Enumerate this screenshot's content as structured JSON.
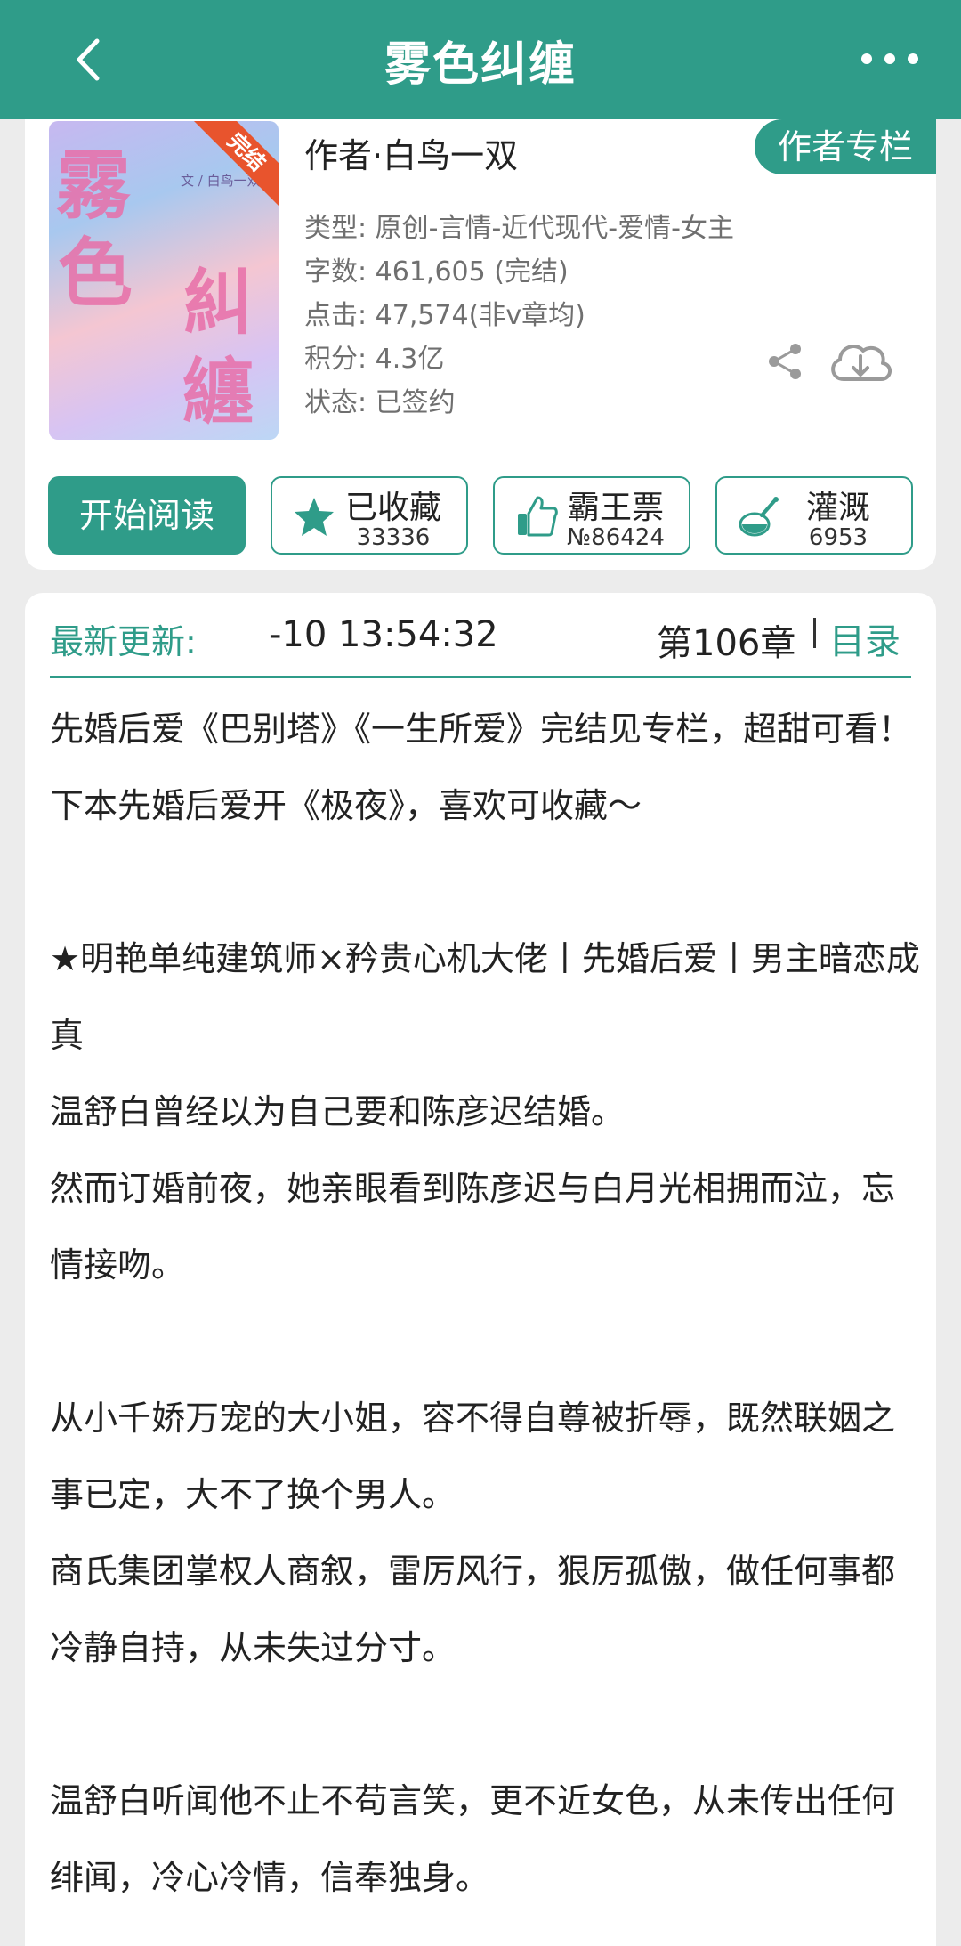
{
  "header": {
    "title": "雾色纠缠"
  },
  "book": {
    "cover": {
      "title_chars": [
        "霧",
        "色",
        "糾",
        "纏"
      ],
      "author_text": "文 / 白鸟一双",
      "badge": "完结"
    },
    "author": "作者·白鸟一双",
    "author_column_label": "作者专栏",
    "meta": {
      "type": "类型: 原创-言情-近代现代-爱情-女主",
      "words": "字数: 461,605 (完结)",
      "clicks": "点击: 47,574(非v章均)",
      "points": "积分: 4.3亿",
      "status": "状态: 已签约"
    },
    "icons": {
      "share": "share-icon",
      "download": "cloud-download-icon"
    }
  },
  "actions": {
    "read": "开始阅读",
    "collect": {
      "label": "已收藏",
      "count": "33336",
      "icon": "star-icon"
    },
    "vote": {
      "label": "霸王票",
      "count": "№86424",
      "icon": "thumbs-up-icon"
    },
    "water": {
      "label": "灌溉",
      "count": "6953",
      "icon": "watering-can-icon"
    }
  },
  "update": {
    "label": "最新更新:",
    "time": "-10 13:54:32",
    "chapter": "第106章",
    "toc": "目录"
  },
  "synopsis": [
    "先婚后爱《巴别塔》《一生所爱》完结见专栏，超甜可看！下本先婚后爱开《极夜》，喜欢可收藏～",
    "",
    "★明艳单纯建筑师×矜贵心机大佬丨先婚后爱丨男主暗恋成真",
    "温舒白曾经以为自己要和陈彦迟结婚。",
    "然而订婚前夜，她亲眼看到陈彦迟与白月光相拥而泣，忘情接吻。",
    "",
    "从小千娇万宠的大小姐，容不得自尊被折辱，既然联姻之事已定，大不了换个男人。",
    "商氏集团掌权人商叙，雷厉风行，狠厉孤傲，做任何事都冷静自持，从未失过分寸。",
    "",
    "温舒白听闻他不止不苟言笑，更不近女色，从未传出任何绯闻，冷心冷情，信奉独身。"
  ],
  "colors": {
    "accent": "#2f9c89",
    "badge": "#e8542d"
  }
}
